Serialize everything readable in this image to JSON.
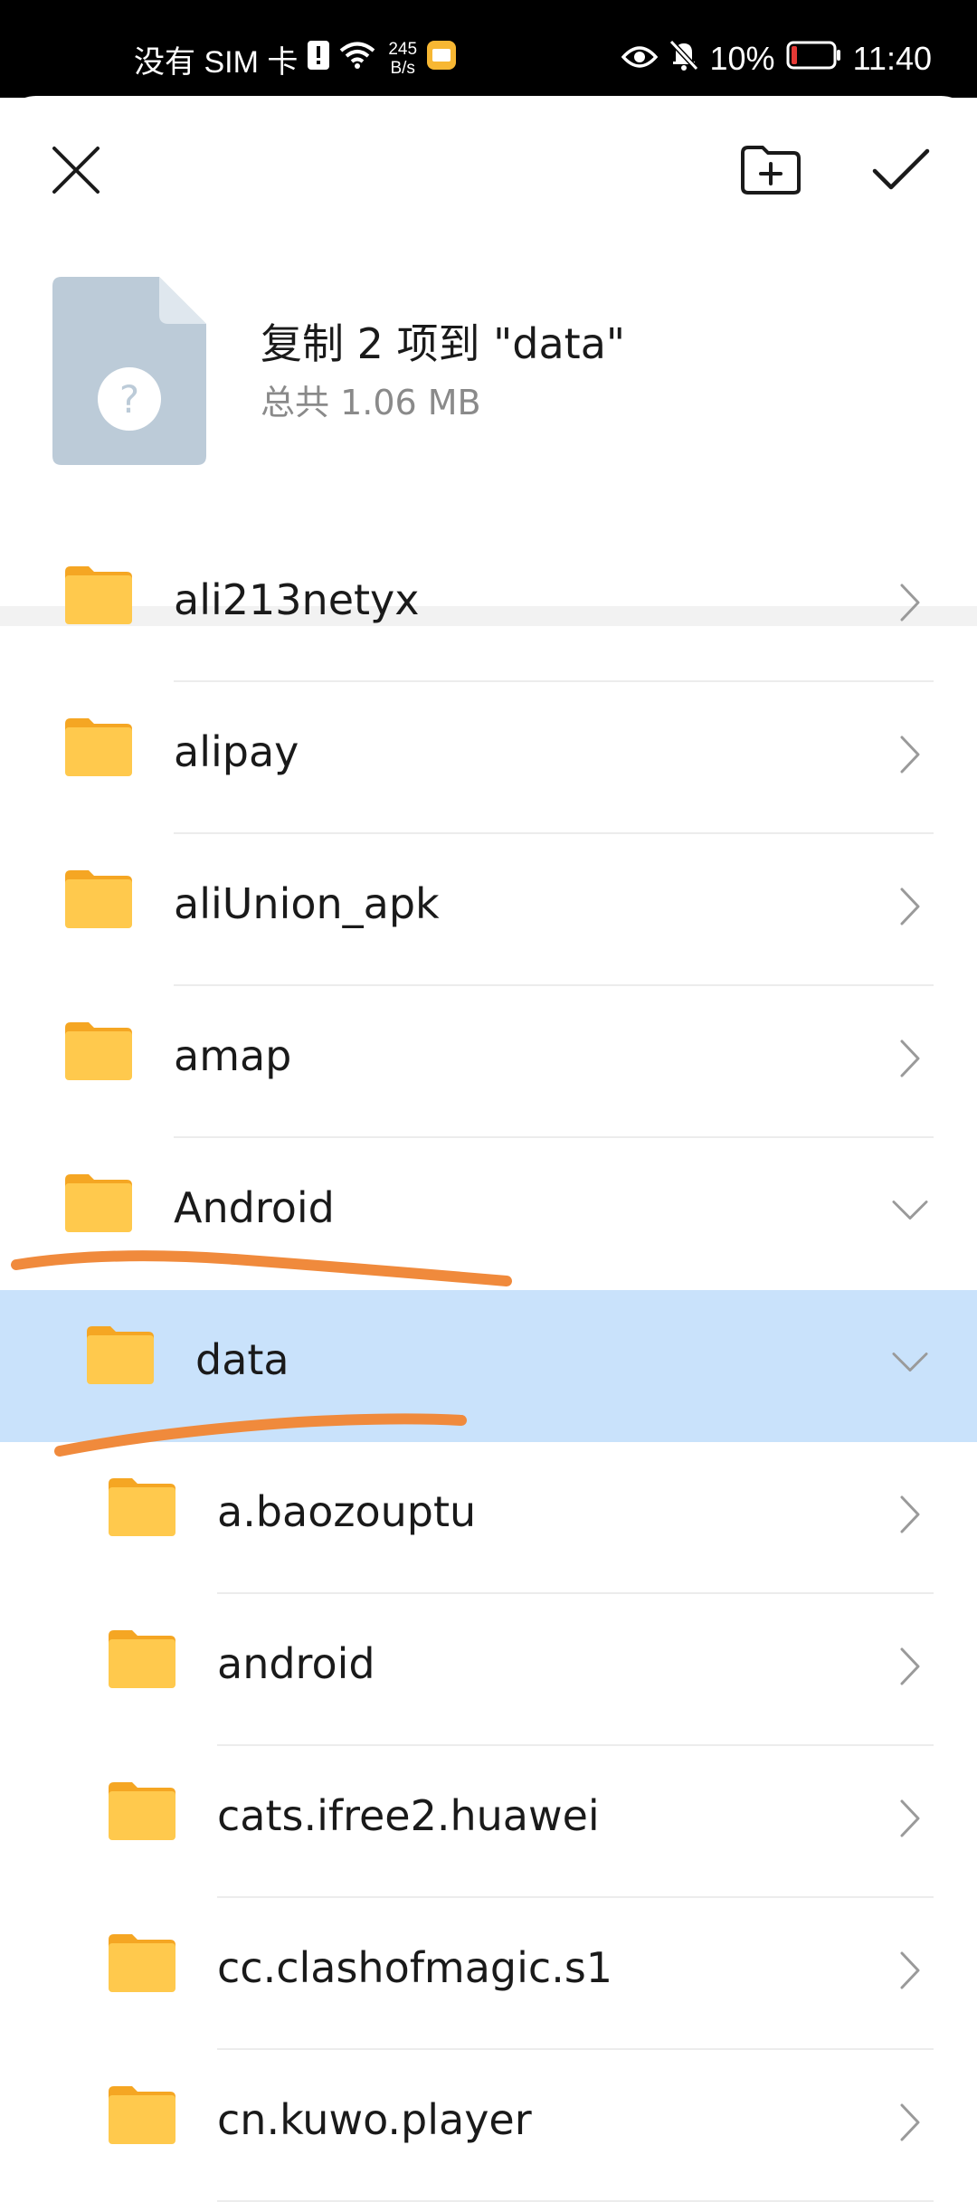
{
  "status_bar": {
    "carrier": "没有 SIM 卡",
    "net_speed_value": "245",
    "net_speed_unit": "B/s",
    "battery_percent": "10%",
    "time": "11:40",
    "icons": [
      "sim-alert-icon",
      "wifi-icon",
      "gallery-app-icon",
      "eye-icon",
      "mute-bell-icon",
      "battery-icon"
    ]
  },
  "toolbar": {
    "close_icon": "close-icon",
    "new_folder_icon": "new-folder-icon",
    "confirm_icon": "check-icon"
  },
  "summary": {
    "title": "复制 2 项到 \"data\"",
    "subtitle": "总共 1.06 MB",
    "thumb_icon": "unknown-file-icon"
  },
  "folders": [
    {
      "name": "ali213netyx",
      "level": 0,
      "state": "collapsed"
    },
    {
      "name": "alipay",
      "level": 0,
      "state": "collapsed"
    },
    {
      "name": "aliUnion_apk",
      "level": 0,
      "state": "collapsed"
    },
    {
      "name": "amap",
      "level": 0,
      "state": "collapsed"
    },
    {
      "name": "Android",
      "level": 0,
      "state": "expanded"
    },
    {
      "name": "data",
      "level": 1,
      "state": "expanded",
      "selected": true
    },
    {
      "name": "a.baozouptu",
      "level": 2,
      "state": "collapsed"
    },
    {
      "name": "android",
      "level": 2,
      "state": "collapsed"
    },
    {
      "name": "cats.ifree2.huawei",
      "level": 2,
      "state": "collapsed"
    },
    {
      "name": "cc.clashofmagic.s1",
      "level": 2,
      "state": "collapsed"
    },
    {
      "name": "cn.kuwo.player",
      "level": 2,
      "state": "collapsed"
    }
  ],
  "colors": {
    "folder": "#FFC94D",
    "folder_tab": "#F5A623",
    "selected_row": "#C9E2FB",
    "annotation_stroke": "#F08A3C"
  }
}
